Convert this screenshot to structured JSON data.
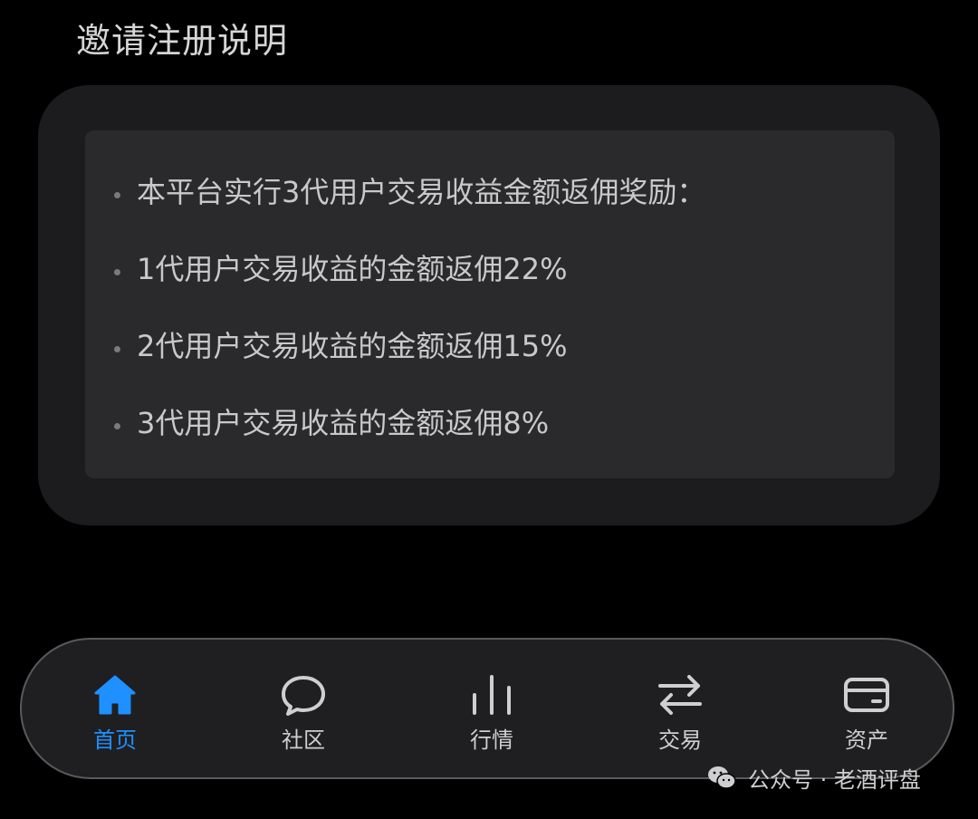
{
  "section": {
    "title": "邀请注册说明"
  },
  "rules": [
    "本平台实行3代用户交易收益金额返佣奖励：",
    "1代用户交易收益的金额返佣22%",
    "2代用户交易收益的金额返佣15%",
    "3代用户交易收益的金额返佣8%"
  ],
  "tabbar": {
    "tabs": [
      {
        "label": "首页",
        "icon": "home-icon",
        "active": true
      },
      {
        "label": "社区",
        "icon": "chat-bubble-icon",
        "active": false
      },
      {
        "label": "行情",
        "icon": "bar-chart-icon",
        "active": false
      },
      {
        "label": "交易",
        "icon": "swap-arrows-icon",
        "active": false
      },
      {
        "label": "资产",
        "icon": "wallet-card-icon",
        "active": false
      }
    ]
  },
  "watermark": {
    "text": "公众号 · 老酒评盘",
    "icon": "wechat-icon"
  },
  "colors": {
    "accent": "#1e90ff",
    "background": "#000000",
    "card": "#1c1c1e",
    "panel": "#2a2a2c"
  }
}
